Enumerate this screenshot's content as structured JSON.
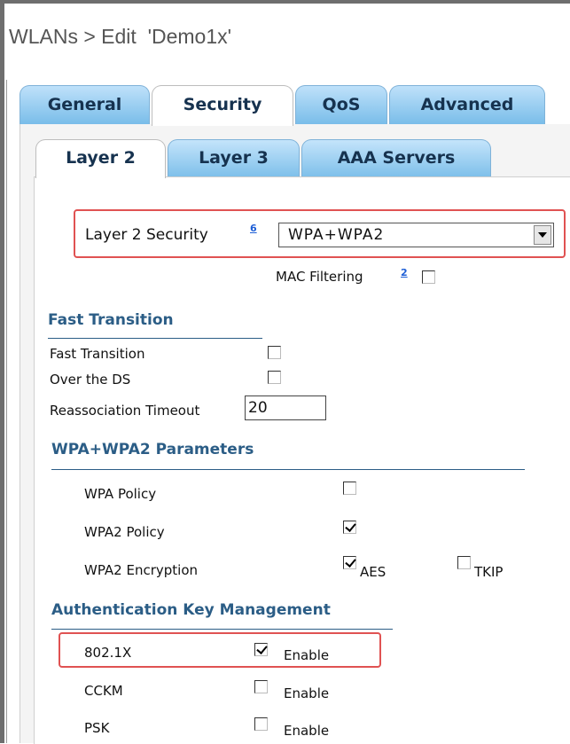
{
  "page": {
    "title": "WLANs > Edit  'Demo1x'"
  },
  "tabs": [
    {
      "label": "General",
      "active": false
    },
    {
      "label": "Security",
      "active": true
    },
    {
      "label": "QoS",
      "active": false
    },
    {
      "label": "Advanced",
      "active": false
    }
  ],
  "subtabs": [
    {
      "label": "Layer 2",
      "active": true
    },
    {
      "label": "Layer 3",
      "active": false
    },
    {
      "label": "AAA Servers",
      "active": false
    }
  ],
  "layer2": {
    "security_label": "Layer 2 Security",
    "security_help": "6",
    "security_value": "WPA+WPA2",
    "mac_filtering_label": "MAC Filtering",
    "mac_filtering_help": "2",
    "mac_filtering_checked": false
  },
  "fast_transition": {
    "heading": "Fast Transition",
    "fast_transition_label": "Fast Transition",
    "fast_transition_checked": false,
    "over_ds_label": "Over the DS",
    "over_ds_checked": false,
    "reassoc_label": "Reassociation Timeout",
    "reassoc_value": "20"
  },
  "wpa": {
    "heading": "WPA+WPA2 Parameters",
    "wpa_policy_label": "WPA Policy",
    "wpa_policy_checked": false,
    "wpa2_policy_label": "WPA2 Policy",
    "wpa2_policy_checked": true,
    "wpa2_encryption_label": "WPA2 Encryption",
    "aes_label": "AES",
    "aes_checked": true,
    "tkip_label": "TKIP",
    "tkip_checked": false
  },
  "akm": {
    "heading": "Authentication Key Management",
    "rows": [
      {
        "name": "802.1X",
        "option": "Enable",
        "checked": true
      },
      {
        "name": "CCKM",
        "option": "Enable",
        "checked": false
      },
      {
        "name": "PSK",
        "option": "Enable",
        "checked": false
      }
    ]
  },
  "colors": {
    "section_heading": "#2b5d86",
    "highlight": "#e05252",
    "tab_blue": "#79bde9"
  }
}
